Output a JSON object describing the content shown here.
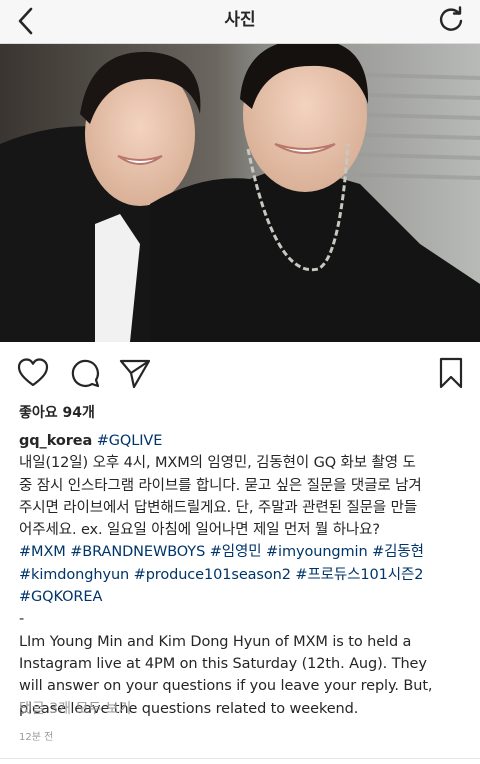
{
  "header": {
    "title": "사진",
    "back_icon": "chevron-left-icon",
    "refresh_icon": "refresh-icon"
  },
  "photo": {
    "alt": "photo"
  },
  "actions": {
    "like_icon": "heart-icon",
    "comment_icon": "comment-icon",
    "share_icon": "share-icon",
    "save_icon": "bookmark-icon"
  },
  "likes": {
    "label": "좋아요 94개"
  },
  "caption": {
    "username": "gq_korea",
    "first_tag": "#GQLIVE",
    "korean_lines": [
      "내일(12일) 오후 4시, MXM의 임영민, 김동현이 GQ 화보 촬영 도",
      "중 잠시 인스타그램 라이브를 합니다. 묻고 싶은 질문을 댓글로 남겨",
      "주시면 라이브에서 답변해드릴게요. 단, 주말과 관련된 질문을 만들",
      "어주세요. ex. 일요일 아침에 일어나면 제일 먼저 뭘 하나요?"
    ],
    "hashtags": [
      [
        "#MXM",
        "#BRANDNEWBOYS",
        "#임영민",
        "#imyoungmin",
        "#김동현"
      ],
      [
        "#kimdonghyun",
        "#produce101season2",
        "#프로듀스101시즌2"
      ],
      [
        "#GQKOREA"
      ]
    ],
    "separator": "-",
    "english_lines": [
      "LIm Young Min and Kim Dong Hyun of MXM is to held a",
      "Instagram live at 4PM on this Saturday (12th. Aug). They",
      "will answer on your questions if you leave your reply. But,",
      "please leave the questions related to weekend."
    ]
  },
  "comments": {
    "label": "댓글 3개 모두 보기"
  },
  "timestamp": "12분 전",
  "colors": {
    "hashtag": "#003569",
    "muted": "#999999",
    "text": "#262626"
  }
}
